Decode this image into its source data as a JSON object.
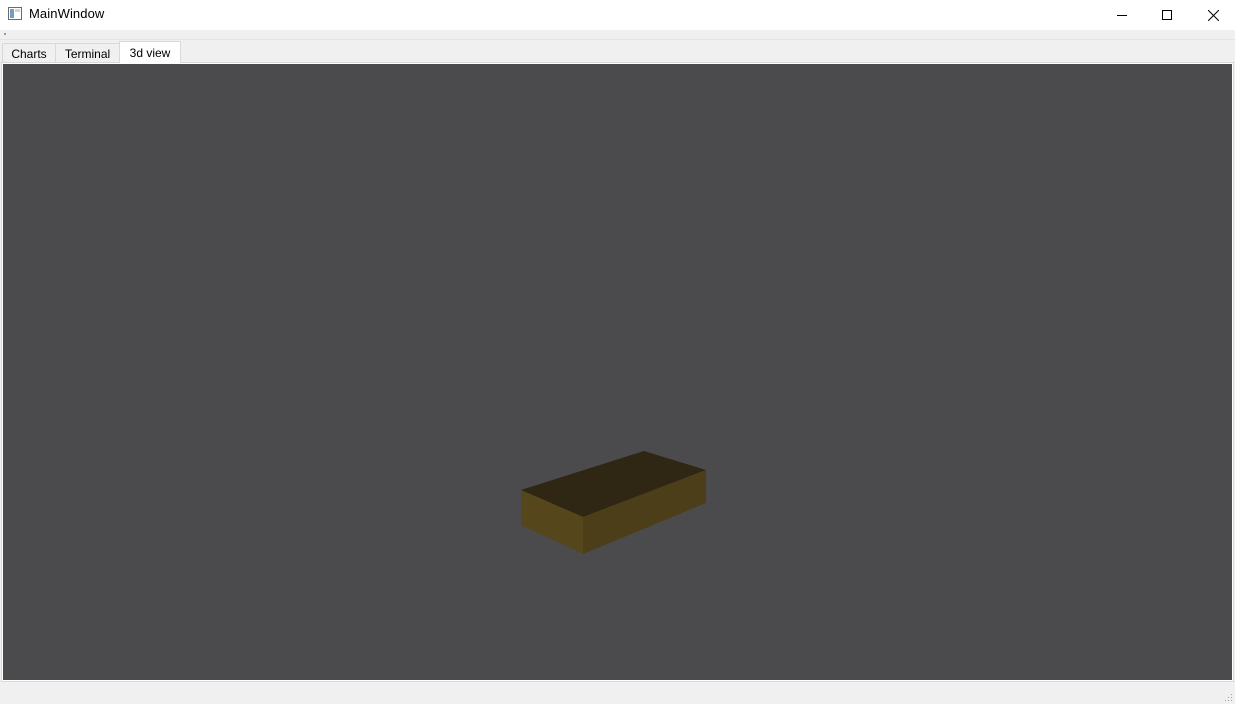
{
  "window": {
    "title": "MainWindow",
    "icon": "window-app-icon",
    "controls": {
      "minimize": "minimize-icon",
      "maximize": "maximize-icon",
      "close": "close-icon"
    }
  },
  "tabs": [
    {
      "label": "Charts",
      "active": false
    },
    {
      "label": "Terminal",
      "active": false
    },
    {
      "label": "3d view",
      "active": true
    }
  ],
  "viewport": {
    "background_color": "#4b4b4d",
    "object": {
      "type": "box",
      "top_face_color": "#2f2714",
      "left_face_color": "#56461c",
      "right_face_color": "#4c3e18"
    }
  },
  "statusbar": {
    "grip": "size-grip-icon"
  }
}
